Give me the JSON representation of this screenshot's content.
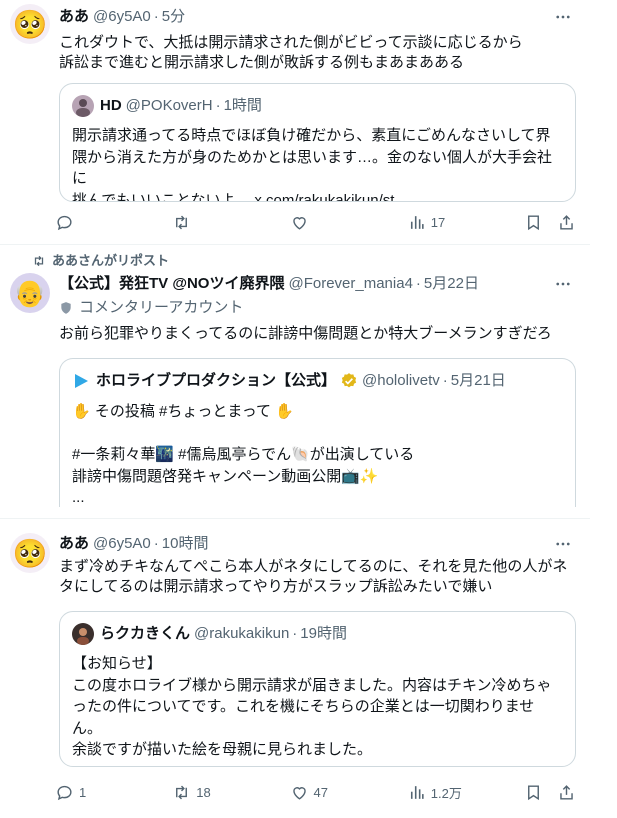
{
  "tweets": [
    {
      "avatar_emoji": "🥺",
      "name": "ああ",
      "handle": "@6y5A0",
      "dot": "·",
      "time": "5分",
      "text": "これダウトで、大抵は開示請求された側がビビって示談に応じるから\n訴訟まで進むと開示請求した側が敗訴する例もまあまあある",
      "quote": {
        "name": "HD",
        "handle": "@POKoverH",
        "dot": "·",
        "time": "1時間",
        "text": "開示請求通ってる時点でほぼ負け確だから、素直にごめんなさいして界\n隈から消えた方が身のためかとは思います…。金のない個人が大手会社に\n挑んでもいいことないよ。 x.com/rakukakikun/st..."
      },
      "stats": {
        "reply": "",
        "repost": "",
        "like": "",
        "views": "17"
      }
    },
    {
      "repost_banner": "ああさんがリポスト",
      "avatar_emoji": "👴",
      "name": "【公式】発狂TV @NOツイ廃界隈",
      "handle": "@Forever_mania4",
      "dot": "·",
      "time": "5月22日",
      "commentary_label": "コメンタリーアカウント",
      "text": "お前ら犯罪やりまくってるのに誹謗中傷問題とか特大ブーメランすぎだろ",
      "quote": {
        "name": "ホロライブプロダクション【公式】",
        "handle": "@hololivetv",
        "dot": "·",
        "time": "5月21日",
        "text": "✋ その投稿 #ちょっとまって ✋\n\n#一条莉々華🌃 #儒烏風亭らでん🐚が出演している\n誹謗中傷問題啓発キャンペーン動画公開📺✨\n..."
      }
    },
    {
      "avatar_emoji": "🥺",
      "name": "ああ",
      "handle": "@6y5A0",
      "dot": "·",
      "time": "10時間",
      "text": "まず冷めチキなんてぺこら本人がネタにしてるのに、それを見た他の人がネ\nタにしてるのは開示請求ってやり方がスラップ訴訟みたいで嫌い",
      "quote": {
        "name": "らクカきくん",
        "handle": "@rakukakikun",
        "dot": "·",
        "time": "19時間",
        "text": "【お知らせ】\nこの度ホロライブ様から開示請求が届きました。内容はチキン冷めちゃ\nったの件についてです。これを機にそちらの企業とは一切関わりませ\nん。\n余談ですが描いた絵を母親に見られました。"
      },
      "stats": {
        "reply": "1",
        "repost": "18",
        "like": "47",
        "views": "1.2万"
      }
    }
  ],
  "icons": {
    "more": "more-icon",
    "reply": "reply-icon",
    "repost": "repost-icon",
    "like": "like-icon",
    "views": "views-icon",
    "bookmark": "bookmark-icon",
    "share": "share-icon",
    "verified": "verified-badge-icon",
    "commentary": "shield-icon"
  },
  "colors": {
    "text": "#0f1419",
    "secondary": "#536471",
    "border": "#cfd9de",
    "verified_gold": "#e2b719"
  }
}
